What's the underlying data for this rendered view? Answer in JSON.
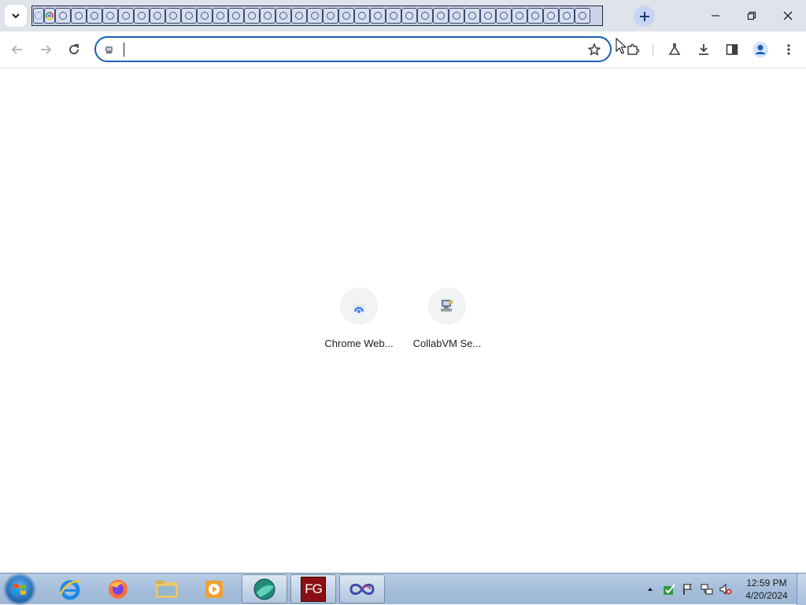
{
  "window": {
    "tab_count": 36,
    "new_tab_label": "+",
    "controls": {
      "minimize": "minimize",
      "restore": "restore",
      "close": "close"
    }
  },
  "toolbar": {
    "back_icon": "arrow-left-icon",
    "forward_icon": "arrow-right-icon",
    "reload_icon": "reload-icon",
    "extensions_icon": "puzzle-icon",
    "labs_icon": "flask-icon",
    "downloads_icon": "download-icon",
    "side_panel_icon": "side-panel-icon",
    "profile_icon": "person-icon",
    "menu_icon": "kebab-menu-icon"
  },
  "omnibox": {
    "value": "",
    "placeholder": "",
    "bookmark_icon": "star-icon"
  },
  "shortcuts": [
    {
      "label": "Chrome Web...",
      "icon": "chrome-web-store-icon"
    },
    {
      "label": "CollabVM Se...",
      "icon": "collabvm-icon"
    }
  ],
  "taskbar": {
    "items": [
      {
        "name": "internet-explorer",
        "icon": "ie-icon"
      },
      {
        "name": "firefox",
        "icon": "firefox-icon"
      },
      {
        "name": "explorer",
        "icon": "folder-icon"
      },
      {
        "name": "media-player",
        "icon": "media-player-icon"
      },
      {
        "name": "app-green-orb",
        "icon": "green-orb-icon"
      },
      {
        "name": "fg-app",
        "icon": "fg-icon",
        "text": "FG"
      },
      {
        "name": "chrome-window",
        "icon": "infinity-icon"
      }
    ],
    "clock": {
      "time": "12:59 PM",
      "date": "4/20/2024"
    }
  },
  "colors": {
    "tabstrip_bg": "#dfe3ea",
    "omnibox_border": "#1a5fb4",
    "taskbar_bg": "#a5bedb",
    "fg_red": "#8b0f14"
  }
}
